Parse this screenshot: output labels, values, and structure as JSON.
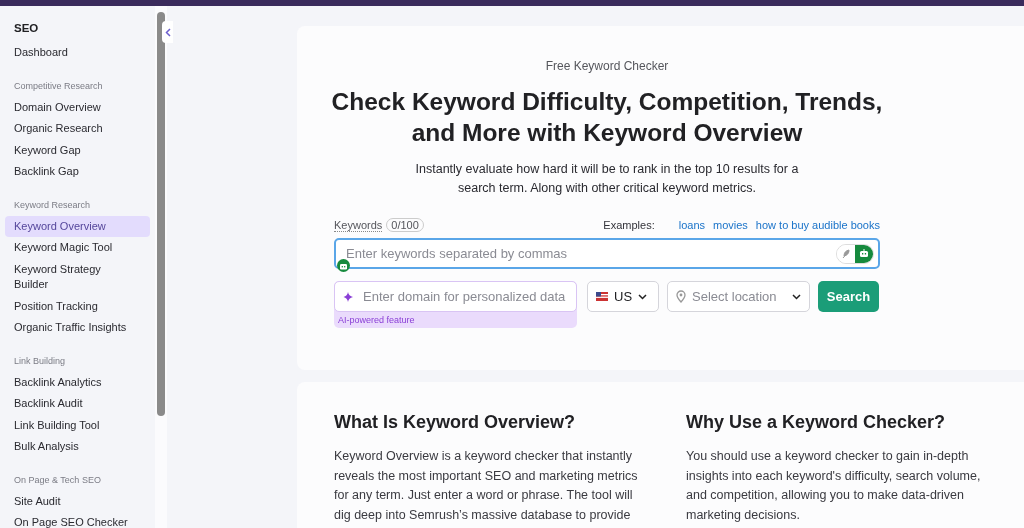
{
  "sidebar": {
    "title": "SEO",
    "groups": [
      {
        "items": [
          {
            "label": "Dashboard",
            "selected": false
          }
        ]
      },
      {
        "heading": "Competitive Research",
        "items": [
          {
            "label": "Domain Overview",
            "selected": false
          },
          {
            "label": "Organic Research",
            "selected": false
          },
          {
            "label": "Keyword Gap",
            "selected": false
          },
          {
            "label": "Backlink Gap",
            "selected": false
          }
        ]
      },
      {
        "heading": "Keyword Research",
        "items": [
          {
            "label": "Keyword Overview",
            "selected": true
          },
          {
            "label": "Keyword Magic Tool",
            "selected": false
          },
          {
            "label": "Keyword Strategy Builder",
            "selected": false
          },
          {
            "label": "Position Tracking",
            "selected": false
          },
          {
            "label": "Organic Traffic Insights",
            "selected": false
          }
        ]
      },
      {
        "heading": "Link Building",
        "items": [
          {
            "label": "Backlink Analytics",
            "selected": false
          },
          {
            "label": "Backlink Audit",
            "selected": false
          },
          {
            "label": "Link Building Tool",
            "selected": false
          },
          {
            "label": "Bulk Analysis",
            "selected": false
          }
        ]
      },
      {
        "heading": "On Page & Tech SEO",
        "items": [
          {
            "label": "Site Audit",
            "selected": false
          },
          {
            "label": "On Page SEO Checker",
            "selected": false
          }
        ]
      }
    ]
  },
  "hero": {
    "eyebrow": "Free Keyword Checker",
    "title": "Check Keyword Difficulty, Competition, Trends, and More with Keyword Overview",
    "subtitle": "Instantly evaluate how hard it will be to rank in the top 10 results for a search term. Along with other critical keyword metrics.",
    "keywords_label": "Keywords",
    "keywords_count": "0/100",
    "examples_label": "Examples:",
    "examples": [
      "loans",
      "movies",
      "how to buy audible books"
    ],
    "keywords_field": {
      "placeholder": "Enter keywords separated by commas",
      "ai_mode": true
    },
    "domain_field": {
      "placeholder": "Enter domain for personalized data"
    },
    "ai_note": "AI-powered feature",
    "country": "US",
    "location": {
      "placeholder": "Select location"
    },
    "search_button": "Search"
  },
  "sections": [
    {
      "title": "What Is Keyword Overview?",
      "body": "Keyword Overview is a keyword checker that instantly reveals the most important SEO and marketing metrics for any term. Just enter a word or phrase. The tool will dig deep into Semrush’s massive database to provide"
    },
    {
      "title": "Why Use a Keyword Checker?",
      "body": "You should use a keyword checker to gain in-depth insights into each keyword's difficulty, search volume, and competition, allowing you to make data-driven marketing decisions."
    }
  ]
}
